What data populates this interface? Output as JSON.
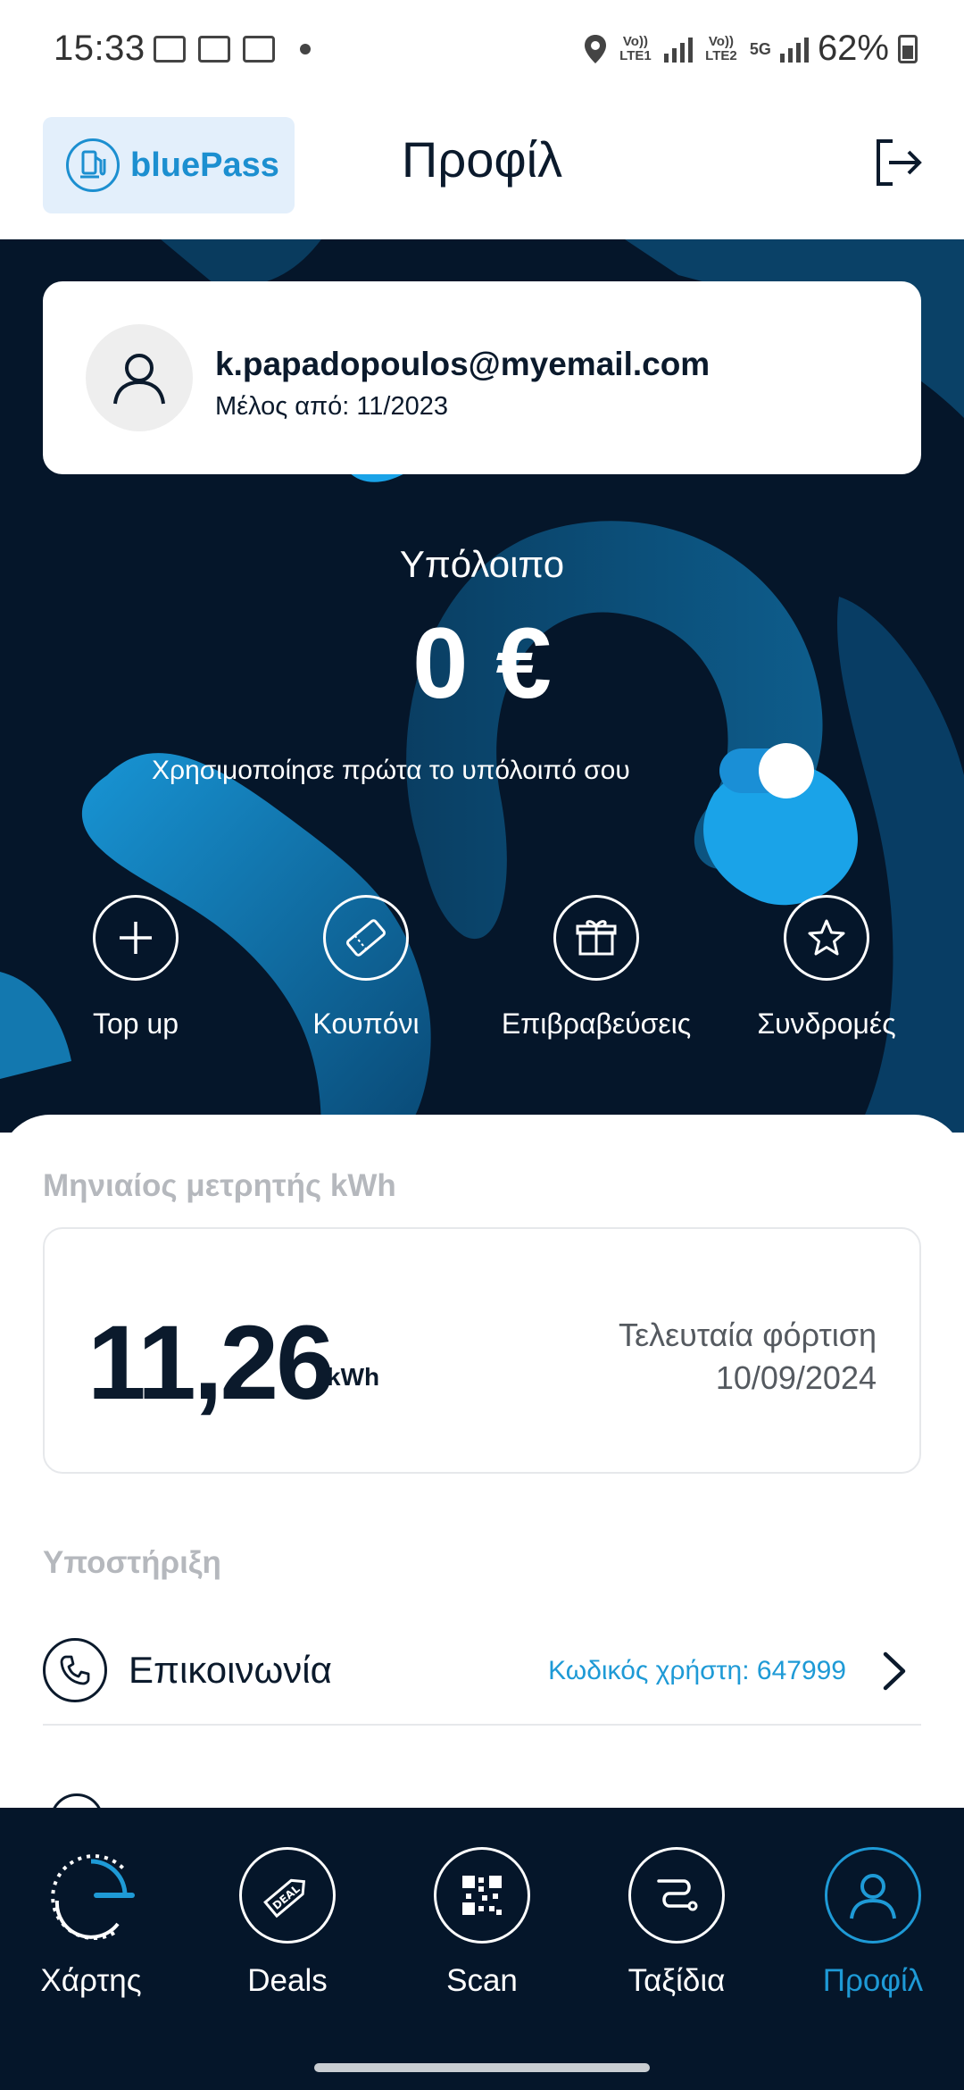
{
  "status_bar": {
    "time": "15:33",
    "network_1": "Vo)) LTE1",
    "network_2": "Vo)) LTE2",
    "network_5g": "5G",
    "battery": "62%"
  },
  "header": {
    "logo_text": "bluePass",
    "title": "Προφίλ"
  },
  "profile": {
    "email": "k.papadopoulos@myemail.com",
    "member_since": "Μέλος από: 11/2023"
  },
  "balance": {
    "label": "Υπόλοιπο",
    "value": "0 €",
    "use_balance_label": "Χρησιμοποίησε πρώτα το υπόλοιπό σου",
    "use_balance_enabled": true
  },
  "actions": [
    {
      "label": "Top up",
      "icon": "plus-icon"
    },
    {
      "label": "Κουπόνι",
      "icon": "coupon-icon"
    },
    {
      "label": "Επιβραβεύσεις",
      "icon": "gift-icon"
    },
    {
      "label": "Συνδρομές",
      "icon": "star-icon"
    }
  ],
  "monthly": {
    "section_title": "Μηνιαίος μετρητής kWh",
    "value": "11,26",
    "unit": "kWh",
    "last_charge_label": "Τελευταία φόρτιση",
    "last_charge_date": "10/09/2024"
  },
  "support": {
    "section_title": "Υποστήριξη",
    "contact_label": "Επικοινωνία",
    "user_code": "Κωδικός χρήστη: 647999"
  },
  "nav": [
    {
      "label": "Χάρτης",
      "icon": "map-gauge-icon",
      "active": false
    },
    {
      "label": "Deals",
      "icon": "deal-tag-icon",
      "active": false
    },
    {
      "label": "Scan",
      "icon": "qr-code-icon",
      "active": false
    },
    {
      "label": "Ταξίδια",
      "icon": "route-icon",
      "active": false
    },
    {
      "label": "Προφίλ",
      "icon": "user-icon",
      "active": true
    }
  ],
  "colors": {
    "accent": "#1e9ad6",
    "dark_bg": "#05162a",
    "logo_bg": "#e3effb"
  }
}
